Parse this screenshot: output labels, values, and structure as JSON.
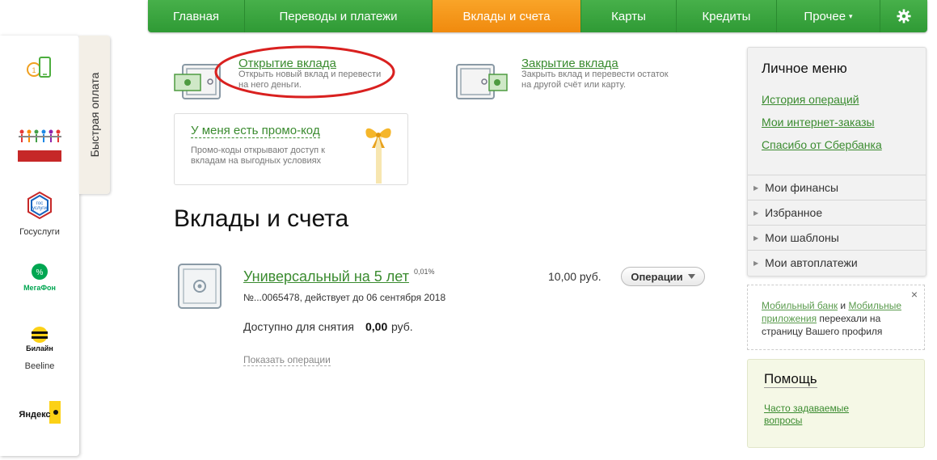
{
  "nav": {
    "items": [
      {
        "label": "Главная"
      },
      {
        "label": "Переводы и платежи"
      },
      {
        "label": "Вклады и счета"
      },
      {
        "label": "Карты"
      },
      {
        "label": "Кредиты"
      },
      {
        "label": "Прочее"
      }
    ],
    "more_arrow": "▾",
    "settings_icon": "gear-icon"
  },
  "quick_pay": {
    "tab_label": "Быстрая оплата",
    "items": [
      {
        "caption": ""
      },
      {
        "caption": ""
      },
      {
        "caption": "Госуслуги"
      },
      {
        "caption": ""
      },
      {
        "caption": "Beeline"
      },
      {
        "caption": ""
      }
    ],
    "logos": {
      "gosuslugi": "гос услуги",
      "megafon": "МегаФон",
      "beeline": "Билайн",
      "yandex": "Яндекс"
    }
  },
  "actions": {
    "open": {
      "title": "Открытие вклада",
      "desc": "Открыть новый вклад и перевести на него деньги."
    },
    "close": {
      "title": "Закрытие вклада",
      "desc": "Закрыть вклад и перевести остаток на другой счёт или карту."
    }
  },
  "promo": {
    "title": "У меня есть промо-код",
    "desc": "Промо-коды открывают доступ к вкладам на выгодных условиях"
  },
  "page_title": "Вклады и счета",
  "deposit": {
    "name": "Универсальный на 5 лет",
    "rate": "0,01%",
    "number": "№...0065478, действует до 06 сентября 2018",
    "available_label": "Доступно для снятия",
    "available_value": "0,00",
    "available_currency": "руб.",
    "balance": "10,00 руб.",
    "operations_button": "Операции",
    "show_operations": "Показать операции"
  },
  "personal_menu": {
    "title": "Личное меню",
    "links": [
      "История операций",
      "Мои интернет-заказы",
      "Спасибо от Сбербанка"
    ],
    "sections": [
      "Мои финансы",
      "Избранное",
      "Мои шаблоны",
      "Мои автоплатежи"
    ]
  },
  "notice": {
    "link1": "Мобильный банк",
    "and": " и ",
    "link2": "Мобильные приложения",
    "rest": " переехали на страницу Вашего профиля",
    "close": "×"
  },
  "help": {
    "title": "Помощь",
    "link": "Часто задаваемые вопросы"
  },
  "colors": {
    "nav_green": "#3aa43f",
    "nav_active_orange": "#f39a1b",
    "link_green": "#3a8b2f",
    "highlight_red": "#d9201f"
  }
}
